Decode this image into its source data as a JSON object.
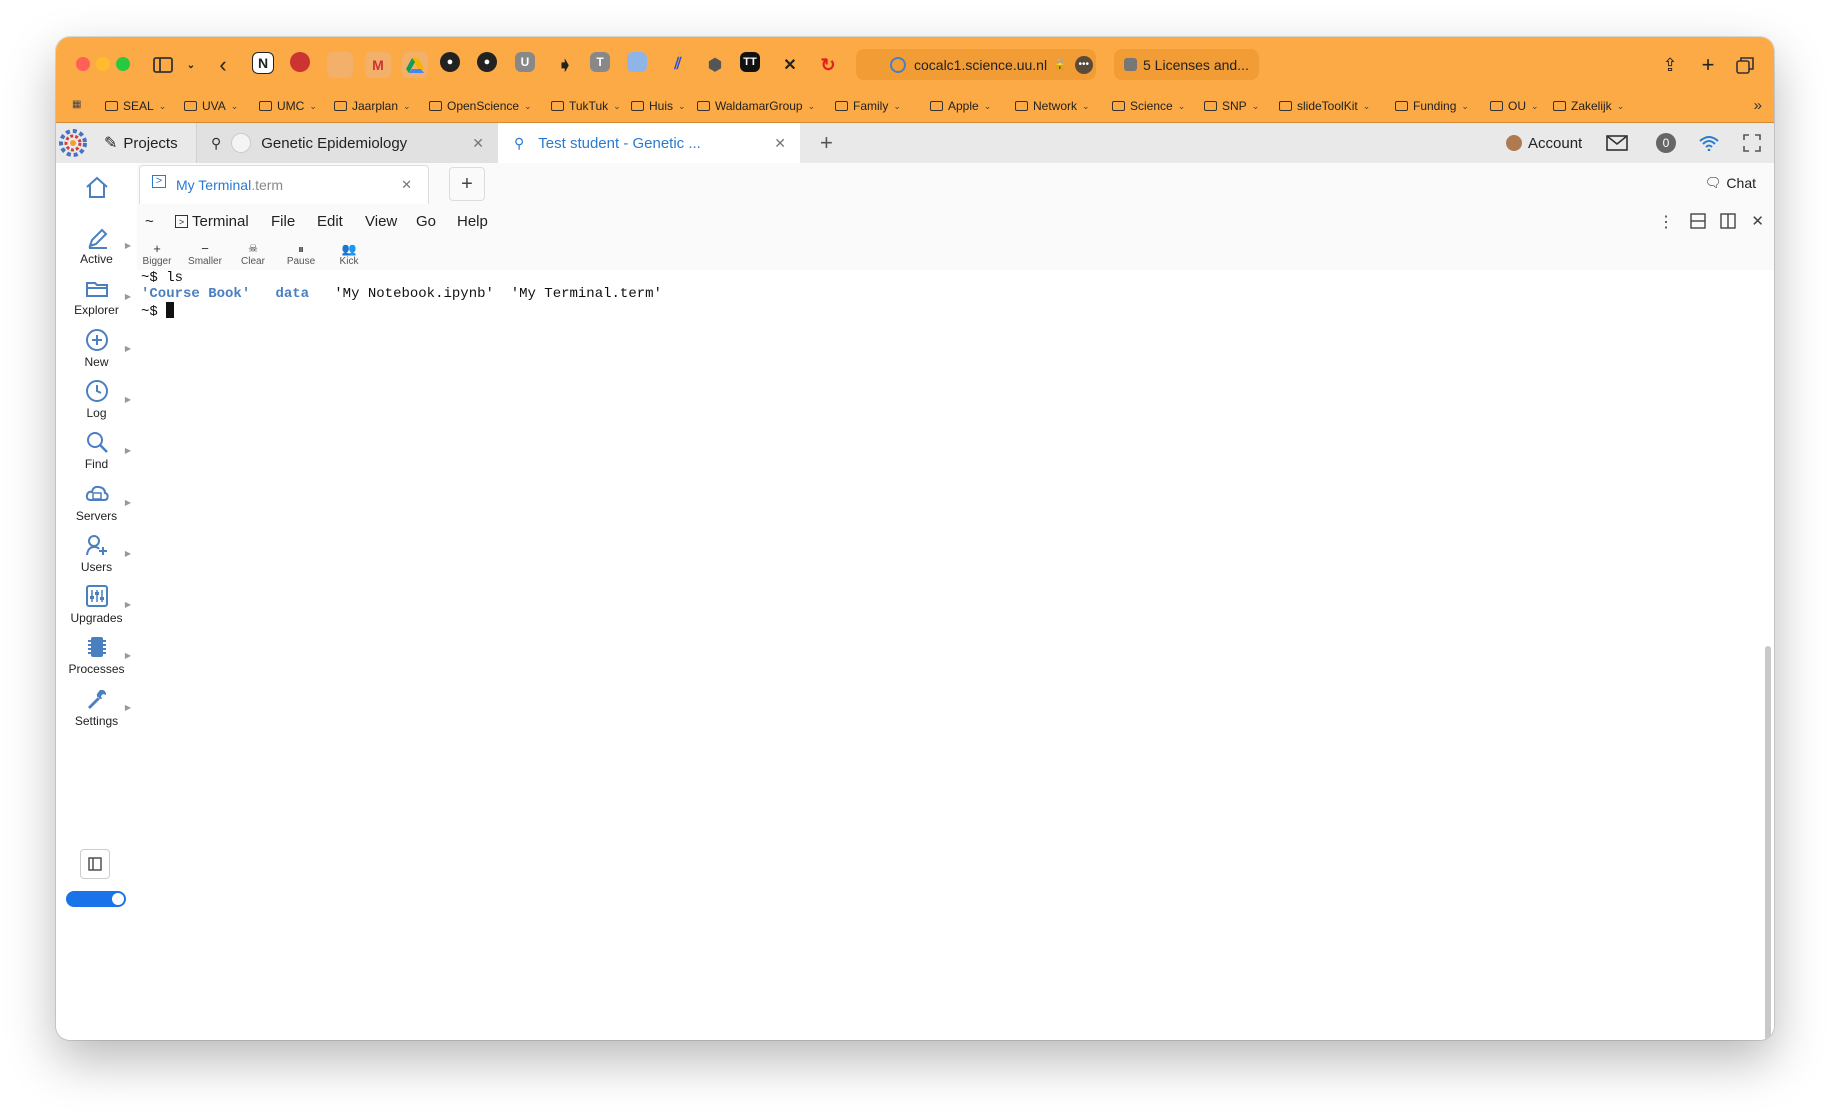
{
  "browser": {
    "url": "cocalc1.science.uu.nl",
    "second_tab": "5 Licenses and...",
    "toolbar_icons": [
      "sidebar-icon",
      "back-icon",
      "notion-icon",
      "app-icon",
      "app-icon",
      "gmail-icon",
      "drive-icon",
      "github-icon",
      "github-icon",
      "u-icon",
      "arrow-icon",
      "t-icon",
      "app-icon",
      "app-icon",
      "hex-icon",
      "tt-icon",
      "app-icon",
      "refresh-icon"
    ],
    "bookmarks": [
      "SEAL",
      "UVA",
      "UMC",
      "Jaarplan",
      "OpenScience",
      "TukTuk",
      "Huis",
      "WaldamarGroup",
      "Family",
      "Apple",
      "Network",
      "Science",
      "SNP",
      "slideToolKit",
      "Funding",
      "OU",
      "Zakelijk"
    ]
  },
  "app": {
    "projects_label": "Projects",
    "tab1": "Genetic Epidemiology",
    "tab2": "Test student - Genetic ...",
    "account": "Account",
    "notif_count": "0"
  },
  "sidebar": {
    "items": [
      {
        "label": "Active",
        "icon": "pencil-icon"
      },
      {
        "label": "Explorer",
        "icon": "folder-icon"
      },
      {
        "label": "New",
        "icon": "plus-circle-icon"
      },
      {
        "label": "Log",
        "icon": "clock-icon"
      },
      {
        "label": "Find",
        "icon": "search-icon"
      },
      {
        "label": "Servers",
        "icon": "cloud-server-icon"
      },
      {
        "label": "Users",
        "icon": "users-icon"
      },
      {
        "label": "Upgrades",
        "icon": "sliders-icon"
      },
      {
        "label": "Processes",
        "icon": "cpu-icon"
      },
      {
        "label": "Settings",
        "icon": "wrench-icon"
      }
    ]
  },
  "editor": {
    "file_tab_name": "My Terminal",
    "file_tab_ext": ".term",
    "chat": "Chat",
    "menu": {
      "home": "~",
      "terminal": "Terminal",
      "file": "File",
      "edit": "Edit",
      "view": "View",
      "go": "Go",
      "help": "Help"
    },
    "tools": [
      "Bigger",
      "Smaller",
      "Clear",
      "Pause",
      "Kick"
    ]
  },
  "terminal": {
    "prompt": "~$ ",
    "command": "ls",
    "dir1": "'Course Book'",
    "dir2": "data",
    "files": "'My Notebook.ipynb'  'My Terminal.term'"
  }
}
